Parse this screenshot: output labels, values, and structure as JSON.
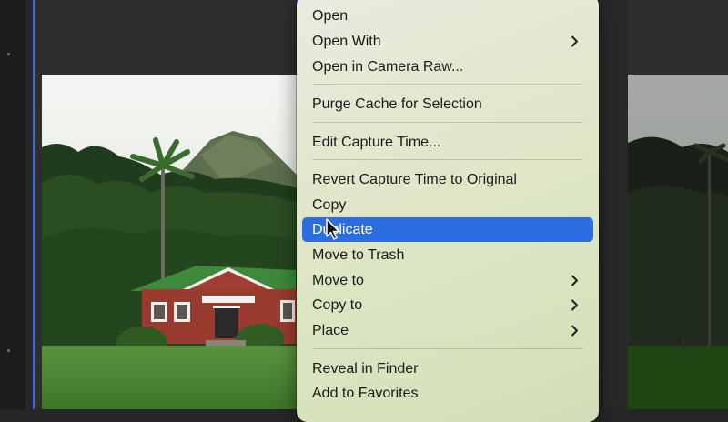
{
  "context_menu": {
    "groups": [
      {
        "items": [
          {
            "label": "Open"
          },
          {
            "label": "Open With",
            "submenu": true
          },
          {
            "label": "Open in Camera Raw..."
          }
        ]
      },
      {
        "items": [
          {
            "label": "Purge Cache for Selection"
          }
        ]
      },
      {
        "items": [
          {
            "label": "Edit Capture Time..."
          }
        ]
      },
      {
        "items": [
          {
            "label": "Revert Capture Time to Original"
          },
          {
            "label": "Copy"
          },
          {
            "label": "Duplicate",
            "highlighted": true
          },
          {
            "label": "Move to Trash"
          },
          {
            "label": "Move to",
            "submenu": true
          },
          {
            "label": "Copy to",
            "submenu": true
          },
          {
            "label": "Place",
            "submenu": true
          }
        ]
      },
      {
        "items": [
          {
            "label": "Reveal in Finder"
          },
          {
            "label": "Add to Favorites"
          }
        ]
      }
    ],
    "highlight_color": "#2c6de0",
    "submenu_icon": "chevron-right-icon"
  },
  "thumbnails": [
    {
      "name": "thumbnail-selected",
      "selected": true
    },
    {
      "name": "thumbnail-right",
      "selected": false
    }
  ],
  "selection_color": "#2f6ae0",
  "cursor_icon": "arrow-cursor-icon"
}
